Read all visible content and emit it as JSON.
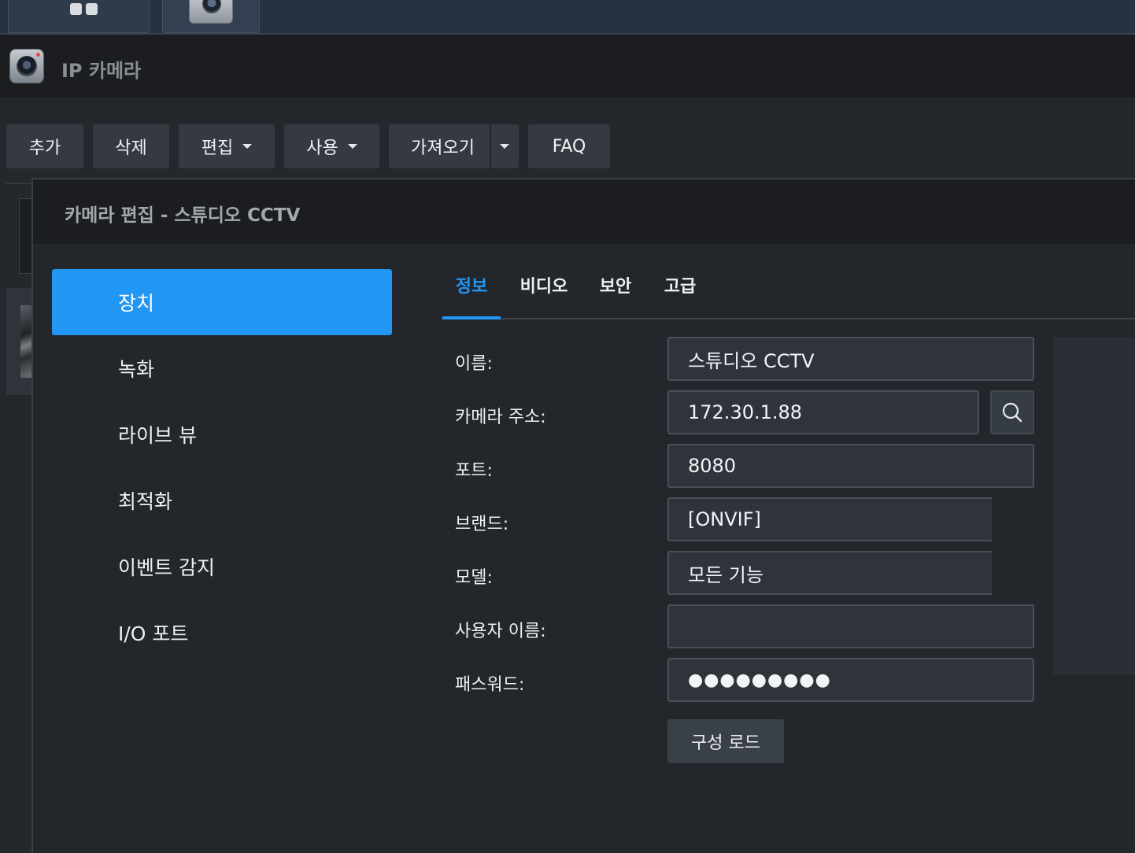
{
  "app": {
    "title": "IP 카메라",
    "icon": "ip-camera-icon"
  },
  "taskbar": {
    "items": [
      {
        "icon": "grid-icon"
      },
      {
        "icon": "camera-icon"
      }
    ]
  },
  "toolbar": {
    "add_label": "추가",
    "delete_label": "삭제",
    "edit_label": "편집",
    "use_label": "사용",
    "import_label": "가져오기",
    "faq_label": "FAQ"
  },
  "dialog": {
    "title": "카메라 편집 - 스튜디오 CCTV",
    "sidebar": {
      "items": [
        {
          "label": "장치",
          "active": true
        },
        {
          "label": "녹화"
        },
        {
          "label": "라이브 뷰"
        },
        {
          "label": "최적화"
        },
        {
          "label": "이벤트 감지"
        },
        {
          "label": "I/O 포트"
        }
      ]
    },
    "tabs": [
      {
        "label": "정보",
        "active": true
      },
      {
        "label": "비디오"
      },
      {
        "label": "보안"
      },
      {
        "label": "고급"
      }
    ],
    "form": {
      "name_label": "이름:",
      "name_value": "스튜디오 CCTV",
      "address_label": "카메라 주소:",
      "address_value": "172.30.1.88",
      "port_label": "포트:",
      "port_value": "8080",
      "brand_label": "브랜드:",
      "brand_value": "[ONVIF]",
      "model_label": "모델:",
      "model_value": "모든 기능",
      "username_label": "사용자 이름:",
      "username_value": "",
      "password_label": "패스워드:",
      "password_value": "●●●●●●●●●",
      "load_config_label": "구성 로드"
    }
  },
  "colors": {
    "accent": "#2196f3",
    "background": "#24272c",
    "header": "#1b1d21"
  }
}
